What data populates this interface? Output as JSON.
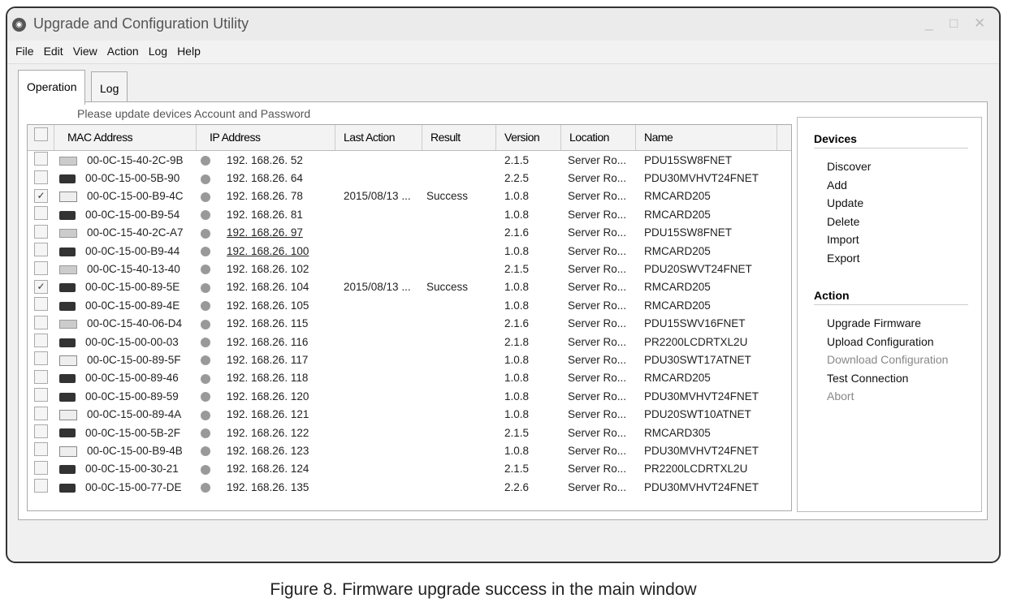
{
  "window": {
    "title": "Upgrade and Configuration Utility",
    "controls": [
      "_",
      "□",
      "✕"
    ]
  },
  "menu": [
    "File",
    "Edit",
    "View",
    "Action",
    "Log",
    "Help"
  ],
  "tabs": [
    "Operation",
    "Log"
  ],
  "hint": "Please update devices Account and Password",
  "columns": [
    "MAC Address",
    "IP Address",
    "Last Action",
    "Result",
    "Version",
    "Location",
    "Name"
  ],
  "rows": [
    {
      "checked": false,
      "icon": "rack",
      "mac": "00-0C-15-40-2C-9B",
      "ip": "192. 168.26. 52",
      "last": "",
      "result": "",
      "version": "2.1.5",
      "location": "Server Ro...",
      "name": "PDU15SW8FNET"
    },
    {
      "checked": false,
      "icon": "card",
      "mac": "00-0C-15-00-5B-90",
      "ip": "192. 168.26. 64",
      "last": "",
      "result": "",
      "version": "2.2.5",
      "location": "Server Ro...",
      "name": "PDU30MVHVT24FNET"
    },
    {
      "checked": true,
      "icon": "pdu",
      "mac": "00-0C-15-00-B9-4C",
      "ip": "192. 168.26. 78",
      "last": "2015/08/13 ...",
      "result": "Success",
      "version": "1.0.8",
      "location": "Server Ro...",
      "name": "RMCARD205"
    },
    {
      "checked": false,
      "icon": "card",
      "mac": "00-0C-15-00-B9-54",
      "ip": "192. 168.26. 81",
      "last": "",
      "result": "",
      "version": "1.0.8",
      "location": "Server Ro...",
      "name": "RMCARD205"
    },
    {
      "checked": false,
      "icon": "rack",
      "mac": "00-0C-15-40-2C-A7",
      "ip": "192. 168.26. 97",
      "last": "",
      "result": "",
      "version": "2.1.6",
      "location": "Server Ro...",
      "name": "PDU15SW8FNET",
      "underline": true
    },
    {
      "checked": false,
      "icon": "card",
      "mac": "00-0C-15-00-B9-44",
      "ip": "192. 168.26. 100",
      "last": "",
      "result": "",
      "version": "1.0.8",
      "location": "Server Ro...",
      "name": "RMCARD205",
      "underline": true
    },
    {
      "checked": false,
      "icon": "rack",
      "mac": "00-0C-15-40-13-40",
      "ip": "192. 168.26. 102",
      "last": "",
      "result": "",
      "version": "2.1.5",
      "location": "Server Ro...",
      "name": "PDU20SWVT24FNET"
    },
    {
      "checked": true,
      "icon": "card",
      "mac": "00-0C-15-00-89-5E",
      "ip": "192. 168.26. 104",
      "last": "2015/08/13 ...",
      "result": "Success",
      "version": "1.0.8",
      "location": "Server Ro...",
      "name": "RMCARD205"
    },
    {
      "checked": false,
      "icon": "card",
      "mac": "00-0C-15-00-89-4E",
      "ip": "192. 168.26. 105",
      "last": "",
      "result": "",
      "version": "1.0.8",
      "location": "Server Ro...",
      "name": "RMCARD205"
    },
    {
      "checked": false,
      "icon": "rack",
      "mac": "00-0C-15-40-06-D4",
      "ip": "192. 168.26. 115",
      "last": "",
      "result": "",
      "version": "2.1.6",
      "location": "Server Ro...",
      "name": "PDU15SWV16FNET"
    },
    {
      "checked": false,
      "icon": "card",
      "mac": "00-0C-15-00-00-03",
      "ip": "192. 168.26. 116",
      "last": "",
      "result": "",
      "version": "2.1.8",
      "location": "Server Ro...",
      "name": "PR2200LCDRTXL2U"
    },
    {
      "checked": false,
      "icon": "pdu",
      "mac": "00-0C-15-00-89-5F",
      "ip": "192. 168.26. 117",
      "last": "",
      "result": "",
      "version": "1.0.8",
      "location": "Server Ro...",
      "name": "PDU30SWT17ATNET"
    },
    {
      "checked": false,
      "icon": "card",
      "mac": "00-0C-15-00-89-46",
      "ip": "192. 168.26. 118",
      "last": "",
      "result": "",
      "version": "1.0.8",
      "location": "Server Ro...",
      "name": "RMCARD205"
    },
    {
      "checked": false,
      "icon": "card",
      "mac": "00-0C-15-00-89-59",
      "ip": "192. 168.26. 120",
      "last": "",
      "result": "",
      "version": "1.0.8",
      "location": "Server Ro...",
      "name": "PDU30MVHVT24FNET"
    },
    {
      "checked": false,
      "icon": "pdu",
      "mac": "00-0C-15-00-89-4A",
      "ip": "192. 168.26. 121",
      "last": "",
      "result": "",
      "version": "1.0.8",
      "location": "Server Ro...",
      "name": "PDU20SWT10ATNET"
    },
    {
      "checked": false,
      "icon": "card",
      "mac": "00-0C-15-00-5B-2F",
      "ip": "192. 168.26. 122",
      "last": "",
      "result": "",
      "version": "2.1.5",
      "location": "Server Ro...",
      "name": "RMCARD305"
    },
    {
      "checked": false,
      "icon": "pdu",
      "mac": "00-0C-15-00-B9-4B",
      "ip": "192. 168.26. 123",
      "last": "",
      "result": "",
      "version": "1.0.8",
      "location": "Server Ro...",
      "name": "PDU30MVHVT24FNET"
    },
    {
      "checked": false,
      "icon": "card",
      "mac": "00-0C-15-00-30-21",
      "ip": "192. 168.26. 124",
      "last": "",
      "result": "",
      "version": "2.1.5",
      "location": "Server Ro...",
      "name": "PR2200LCDRTXL2U"
    },
    {
      "checked": false,
      "icon": "card",
      "mac": "00-0C-15-00-77-DE",
      "ip": "192. 168.26. 135",
      "last": "",
      "result": "",
      "version": "2.2.6",
      "location": "Server Ro...",
      "name": "PDU30MVHVT24FNET"
    }
  ],
  "side": {
    "devices_title": "Devices",
    "devices": [
      {
        "label": "Discover"
      },
      {
        "label": "Add"
      },
      {
        "label": "Update"
      },
      {
        "label": "Delete"
      },
      {
        "label": "Import"
      },
      {
        "label": "Export"
      }
    ],
    "action_title": "Action",
    "actions": [
      {
        "label": "Upgrade Firmware"
      },
      {
        "label": "Upload Configuration"
      },
      {
        "label": "Download Configuration",
        "disabled": true
      },
      {
        "label": "Test Connection"
      },
      {
        "label": "Abort",
        "disabled": true
      }
    ]
  },
  "caption": "Figure 8. Firmware upgrade success in the main window"
}
